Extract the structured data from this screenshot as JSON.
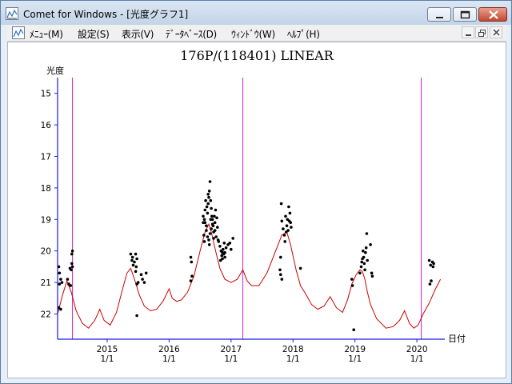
{
  "window": {
    "title": "Comet for Windows - [光度グラフ1]"
  },
  "menu": {
    "items": [
      {
        "label": "ﾒﾆｭｰ(M)"
      },
      {
        "label": "設定(S)"
      },
      {
        "label": "表示(V)"
      },
      {
        "label": "ﾃﾞｰﾀﾍﾞｰｽ(D)"
      },
      {
        "label": "ｳｨﾝﾄﾞｳ(W)"
      },
      {
        "label": "ﾍﾙﾌﾟ(H)"
      }
    ]
  },
  "colors": {
    "axis": "#1a1ae6",
    "marker_line": "#cc22cc",
    "curve": "#cc0000",
    "points": "#000000"
  },
  "chart_data": {
    "type": "scatter",
    "title": "176P/(118401) LINEAR",
    "ylabel": "光度",
    "xlabel": "日付",
    "y_inverted": true,
    "ylim": [
      22.8,
      14.5
    ],
    "xlim": [
      2014.2,
      2020.45
    ],
    "y_ticks": [
      15,
      16,
      17,
      18,
      19,
      20,
      21,
      22
    ],
    "x_ticks": [
      {
        "x": 2015.0,
        "year": "2015",
        "date": "1/1"
      },
      {
        "x": 2016.0,
        "year": "2016",
        "date": "1/1"
      },
      {
        "x": 2017.0,
        "year": "2017",
        "date": "1/1"
      },
      {
        "x": 2018.0,
        "year": "2018",
        "date": "1/1"
      },
      {
        "x": 2019.0,
        "year": "2019",
        "date": "1/1"
      },
      {
        "x": 2020.0,
        "year": "2020",
        "date": "1/1"
      }
    ],
    "vertical_markers": [
      2014.44,
      2017.19,
      2020.07
    ],
    "curve": {
      "x": [
        2014.2,
        2014.28,
        2014.35,
        2014.42,
        2014.5,
        2014.6,
        2014.7,
        2014.8,
        2014.88,
        2014.95,
        2015.05,
        2015.15,
        2015.25,
        2015.32,
        2015.38,
        2015.45,
        2015.52,
        2015.6,
        2015.7,
        2015.8,
        2015.9,
        2016.0,
        2016.05,
        2016.12,
        2016.2,
        2016.3,
        2016.4,
        2016.5,
        2016.58,
        2016.64,
        2016.68,
        2016.75,
        2016.82,
        2016.9,
        2017.0,
        2017.1,
        2017.19,
        2017.26,
        2017.33,
        2017.45,
        2017.58,
        2017.7,
        2017.82,
        2017.9,
        2017.96,
        2018.05,
        2018.12,
        2018.2,
        2018.3,
        2018.4,
        2018.5,
        2018.6,
        2018.7,
        2018.8,
        2018.88,
        2018.95,
        2019.02,
        2019.08,
        2019.12,
        2019.16,
        2019.2,
        2019.25,
        2019.35,
        2019.5,
        2019.62,
        2019.72,
        2019.8,
        2019.88,
        2019.95,
        2020.02,
        2020.1,
        2020.2,
        2020.3,
        2020.38
      ],
      "y": [
        22.0,
        21.4,
        20.95,
        21.3,
        21.9,
        22.3,
        22.45,
        22.2,
        21.85,
        22.2,
        22.35,
        21.95,
        21.2,
        20.7,
        20.55,
        20.95,
        21.4,
        21.75,
        21.9,
        21.85,
        21.6,
        21.2,
        21.5,
        21.6,
        21.55,
        21.3,
        20.8,
        20.0,
        19.4,
        19.15,
        19.4,
        20.0,
        20.55,
        20.9,
        21.0,
        20.9,
        20.6,
        20.95,
        21.1,
        21.1,
        20.7,
        20.1,
        19.5,
        19.4,
        19.8,
        20.6,
        21.1,
        21.35,
        21.7,
        21.85,
        21.75,
        21.45,
        21.8,
        21.95,
        21.55,
        21.05,
        20.75,
        20.6,
        20.65,
        20.9,
        21.3,
        21.7,
        22.15,
        22.45,
        22.4,
        22.2,
        21.9,
        22.3,
        22.45,
        22.35,
        22.0,
        21.65,
        21.2,
        20.9
      ]
    },
    "points": [
      [
        2014.22,
        20.5
      ],
      [
        2014.23,
        20.7
      ],
      [
        2014.25,
        20.9
      ],
      [
        2014.23,
        21.05
      ],
      [
        2014.27,
        21.0
      ],
      [
        2014.22,
        21.8
      ],
      [
        2014.25,
        21.85
      ],
      [
        2014.36,
        20.9
      ],
      [
        2014.38,
        21.05
      ],
      [
        2014.41,
        21.1
      ],
      [
        2014.42,
        20.6
      ],
      [
        2014.43,
        20.4
      ],
      [
        2014.44,
        20.5
      ],
      [
        2014.43,
        20.1
      ],
      [
        2014.44,
        20.0
      ],
      [
        2014.4,
        20.55
      ],
      [
        2015.38,
        20.1
      ],
      [
        2015.4,
        20.3
      ],
      [
        2015.42,
        20.45
      ],
      [
        2015.41,
        20.2
      ],
      [
        2015.44,
        20.35
      ],
      [
        2015.46,
        20.1
      ],
      [
        2015.47,
        20.5
      ],
      [
        2015.48,
        20.25
      ],
      [
        2015.46,
        20.65
      ],
      [
        2015.5,
        21.0
      ],
      [
        2015.48,
        21.05
      ],
      [
        2015.55,
        20.75
      ],
      [
        2015.57,
        20.9
      ],
      [
        2015.6,
        21.0
      ],
      [
        2015.63,
        20.7
      ],
      [
        2015.48,
        22.05
      ],
      [
        2016.35,
        20.2
      ],
      [
        2016.36,
        20.35
      ],
      [
        2016.37,
        20.8
      ],
      [
        2016.35,
        20.95
      ],
      [
        2016.55,
        18.9
      ],
      [
        2016.57,
        19.0
      ],
      [
        2016.58,
        19.1
      ],
      [
        2016.6,
        19.2
      ],
      [
        2016.62,
        18.8
      ],
      [
        2016.63,
        18.5
      ],
      [
        2016.64,
        18.3
      ],
      [
        2016.65,
        18.1
      ],
      [
        2016.66,
        17.8
      ],
      [
        2016.67,
        18.4
      ],
      [
        2016.68,
        18.65
      ],
      [
        2016.69,
        18.9
      ],
      [
        2016.7,
        19.0
      ],
      [
        2016.71,
        19.2
      ],
      [
        2016.72,
        19.4
      ],
      [
        2016.73,
        18.9
      ],
      [
        2016.74,
        19.1
      ],
      [
        2016.75,
        18.7
      ],
      [
        2016.77,
        18.95
      ],
      [
        2016.78,
        19.25
      ],
      [
        2016.6,
        19.35
      ],
      [
        2016.62,
        19.55
      ],
      [
        2016.64,
        19.65
      ],
      [
        2016.66,
        19.45
      ],
      [
        2016.68,
        19.3
      ],
      [
        2016.72,
        19.6
      ],
      [
        2016.55,
        19.1
      ],
      [
        2016.56,
        19.5
      ],
      [
        2016.57,
        19.7
      ],
      [
        2016.58,
        18.7
      ],
      [
        2016.59,
        18.4
      ],
      [
        2016.61,
        18.6
      ],
      [
        2016.63,
        18.2
      ],
      [
        2016.65,
        19.8
      ],
      [
        2016.67,
        19.0
      ],
      [
        2016.7,
        19.15
      ],
      [
        2016.74,
        19.35
      ],
      [
        2016.76,
        19.55
      ],
      [
        2016.79,
        19.65
      ],
      [
        2016.8,
        19.7
      ],
      [
        2016.82,
        19.85
      ],
      [
        2016.84,
        20.0
      ],
      [
        2016.85,
        20.15
      ],
      [
        2016.86,
        20.25
      ],
      [
        2016.87,
        19.95
      ],
      [
        2016.88,
        20.1
      ],
      [
        2016.89,
        19.75
      ],
      [
        2016.9,
        20.05
      ],
      [
        2016.92,
        19.9
      ],
      [
        2016.95,
        19.8
      ],
      [
        2016.98,
        19.75
      ],
      [
        2017.0,
        19.95
      ],
      [
        2017.03,
        19.6
      ],
      [
        2016.83,
        20.3
      ],
      [
        2016.86,
        20.05
      ],
      [
        2016.9,
        20.2
      ],
      [
        2017.81,
        18.5
      ],
      [
        2017.82,
        19.05
      ],
      [
        2017.84,
        19.3
      ],
      [
        2017.86,
        19.5
      ],
      [
        2017.87,
        19.7
      ],
      [
        2017.88,
        18.9
      ],
      [
        2017.9,
        19.2
      ],
      [
        2017.91,
        19.0
      ],
      [
        2017.92,
        19.35
      ],
      [
        2017.93,
        18.6
      ],
      [
        2017.95,
        18.8
      ],
      [
        2017.96,
        19.1
      ],
      [
        2017.97,
        19.25
      ],
      [
        2017.8,
        20.2
      ],
      [
        2017.79,
        20.6
      ],
      [
        2017.8,
        20.75
      ],
      [
        2017.82,
        20.9
      ],
      [
        2017.89,
        19.4
      ],
      [
        2017.94,
        19.05
      ],
      [
        2018.12,
        20.55
      ],
      [
        2018.95,
        20.9
      ],
      [
        2018.96,
        21.1
      ],
      [
        2018.98,
        22.5
      ],
      [
        2019.08,
        20.7
      ],
      [
        2019.1,
        20.5
      ],
      [
        2019.11,
        20.35
      ],
      [
        2019.12,
        20.25
      ],
      [
        2019.13,
        20.0
      ],
      [
        2019.14,
        20.2
      ],
      [
        2019.15,
        20.4
      ],
      [
        2019.16,
        20.6
      ],
      [
        2019.17,
        20.05
      ],
      [
        2019.18,
        19.9
      ],
      [
        2019.19,
        19.45
      ],
      [
        2019.2,
        20.3
      ],
      [
        2019.25,
        19.8
      ],
      [
        2019.27,
        20.7
      ],
      [
        2019.28,
        20.8
      ],
      [
        2020.2,
        20.3
      ],
      [
        2020.21,
        21.05
      ],
      [
        2020.22,
        20.45
      ],
      [
        2020.23,
        20.95
      ],
      [
        2020.25,
        20.35
      ],
      [
        2020.26,
        20.5
      ],
      [
        2020.27,
        20.4
      ]
    ]
  }
}
